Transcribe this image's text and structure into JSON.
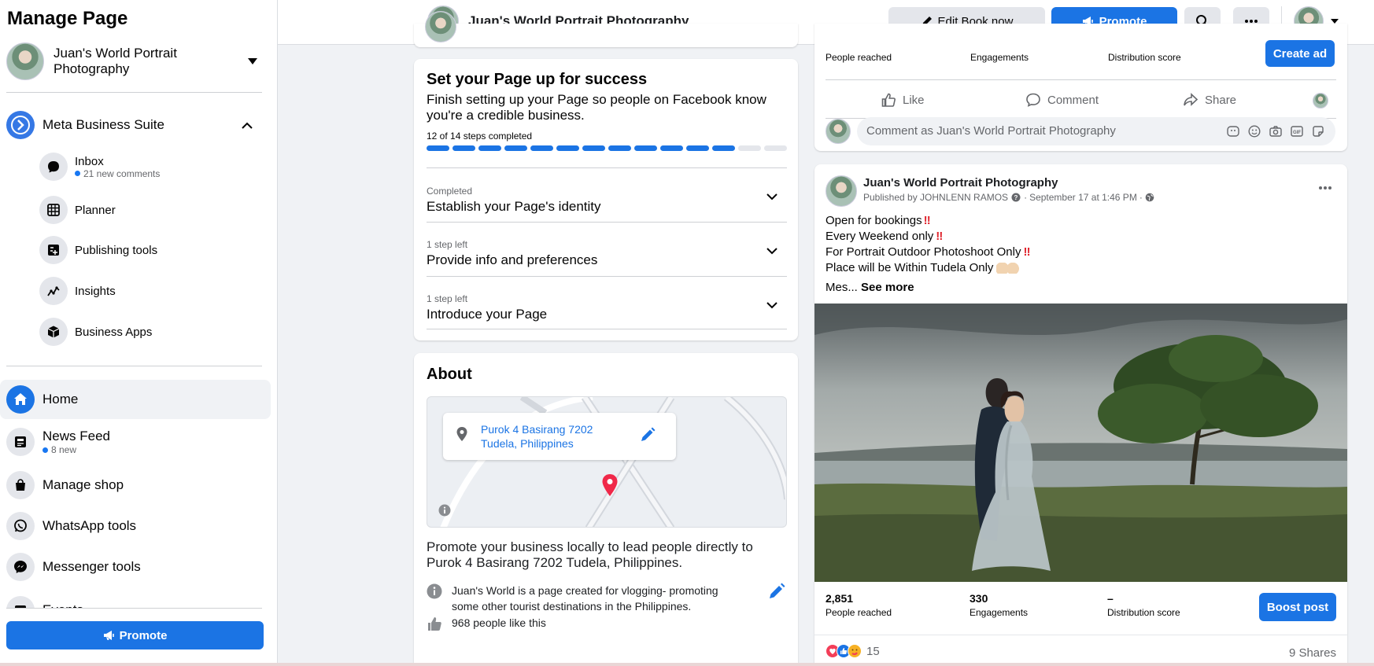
{
  "sidebar": {
    "title": "Manage Page",
    "page_name": "Juan's World Portrait Photography",
    "business_suite": "Meta Business Suite",
    "sub_items": [
      {
        "label": "Inbox",
        "note": "21 new comments",
        "icon": "chat-bubble-icon"
      },
      {
        "label": "Planner",
        "icon": "calendar-grid-icon"
      },
      {
        "label": "Publishing tools",
        "icon": "publishing-tools-icon"
      },
      {
        "label": "Insights",
        "icon": "insights-graph-icon"
      },
      {
        "label": "Business Apps",
        "icon": "cube-icon"
      }
    ],
    "nav": [
      {
        "label": "Home",
        "icon": "home-icon"
      },
      {
        "label": "News Feed",
        "note": "8 new",
        "icon": "news-feed-icon"
      },
      {
        "label": "Manage shop",
        "icon": "shopping-bag-icon"
      },
      {
        "label": "WhatsApp tools",
        "icon": "whatsapp-icon"
      },
      {
        "label": "Messenger tools",
        "icon": "messenger-icon"
      },
      {
        "label": "Events",
        "icon": "calendar-icon"
      }
    ],
    "promote_label": "Promote"
  },
  "topbar": {
    "page_name": "Juan's World Portrait Photography",
    "edit_label": "Edit Book now",
    "promote_label": "Promote"
  },
  "setup": {
    "title": "Set your Page up for success",
    "description": "Finish setting up your Page so people on Facebook know you're a credible business.",
    "progress_text": "12 of 14 steps completed",
    "progress_completed": 12,
    "progress_total": 14,
    "steps": [
      {
        "status": "Completed",
        "title": "Establish your Page's identity"
      },
      {
        "status": "1 step left",
        "title": "Provide info and preferences"
      },
      {
        "status": "1 step left",
        "title": "Introduce your Page"
      }
    ]
  },
  "about": {
    "title": "About",
    "address_line1": "Purok 4 Basirang 7202",
    "address_line2": "Tudela, Philippines",
    "promo_text": "Promote your business locally to lead people directly to Purok 4 Basirang 7202 Tudela, Philippines.",
    "description": "Juan's World is a page created for vlogging- promoting some other tourist destinations in the Philippines.",
    "likes": "968 people like this"
  },
  "top_post": {
    "reached_label": "People reached",
    "engagements_label": "Engagements",
    "distribution_label": "Distribution score",
    "create_ad_label": "Create ad",
    "like_label": "Like",
    "comment_label": "Comment",
    "share_label": "Share",
    "comment_placeholder": "Comment as Juan's World Portrait Photography"
  },
  "post": {
    "author": "Juan's World Portrait Photography",
    "published_by": "Published by JOHNLENN RAMOS",
    "date": "September 17 at 1:46 PM",
    "lines": [
      "Open for bookings",
      "Every Weekend only",
      "For Portrait Outdoor Photoshoot Only",
      "Place will be Within Tudela Only"
    ],
    "more_prefix": "Mes...",
    "see_more": "See more",
    "reached": "2,851",
    "reached_label": "People reached",
    "engagements": "330",
    "engagements_label": "Engagements",
    "distribution": "–",
    "distribution_label": "Distribution score",
    "boost_label": "Boost post",
    "reaction_count": "15",
    "shares": "9 Shares"
  },
  "colors": {
    "accent": "#1b74e4",
    "background": "#f0f2f5",
    "pin": "#f02849"
  }
}
